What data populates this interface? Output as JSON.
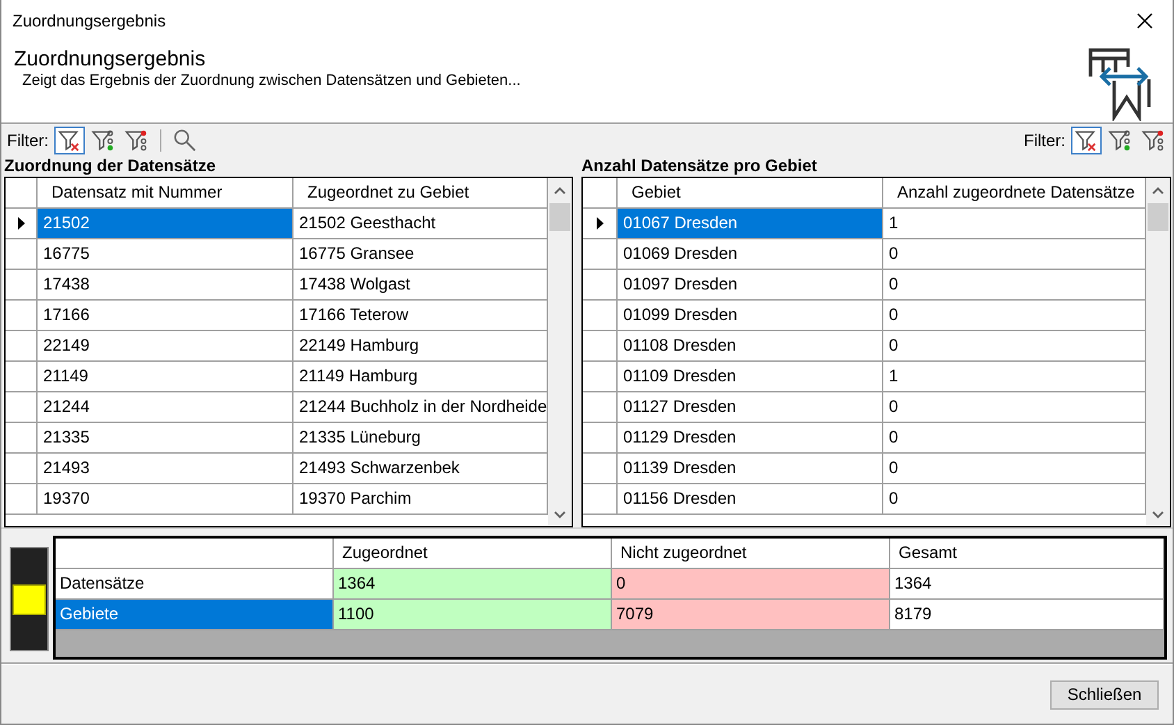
{
  "window": {
    "title": "Zuordnungsergebnis"
  },
  "header": {
    "title": "Zuordnungsergebnis",
    "subtitle": "Zeigt das Ergebnis der Zuordnung zwischen Datensätzen und Gebieten..."
  },
  "filters": [
    {
      "label": "Filter:",
      "buttons": [
        {
          "kind": "clear",
          "selected": true
        },
        {
          "kind": "assigned",
          "selected": false
        },
        {
          "kind": "unassigned",
          "selected": false
        },
        {
          "kind": "search",
          "selected": false
        }
      ]
    },
    {
      "label": "Filter:",
      "buttons": [
        {
          "kind": "clear",
          "selected": true
        },
        {
          "kind": "assigned",
          "selected": false
        },
        {
          "kind": "unassigned",
          "selected": false
        }
      ]
    }
  ],
  "grids": [
    {
      "title": "Zuordnung der Datensätze",
      "columns": [
        "Datensatz mit Nummer",
        "Zugeordnet zu Gebiet"
      ],
      "rows": [
        {
          "cells": [
            "21502",
            "21502 Geesthacht"
          ],
          "selected": true
        },
        {
          "cells": [
            "16775",
            "16775 Gransee"
          ],
          "selected": false
        },
        {
          "cells": [
            "17438",
            "17438 Wolgast"
          ],
          "selected": false
        },
        {
          "cells": [
            "17166",
            "17166 Teterow"
          ],
          "selected": false
        },
        {
          "cells": [
            "22149",
            "22149 Hamburg"
          ],
          "selected": false
        },
        {
          "cells": [
            "21149",
            "21149 Hamburg"
          ],
          "selected": false
        },
        {
          "cells": [
            "21244",
            "21244 Buchholz in der Nordheide"
          ],
          "selected": false
        },
        {
          "cells": [
            "21335",
            "21335 Lüneburg"
          ],
          "selected": false
        },
        {
          "cells": [
            "21493",
            "21493 Schwarzenbek"
          ],
          "selected": false
        },
        {
          "cells": [
            "19370",
            "19370 Parchim"
          ],
          "selected": false
        }
      ]
    },
    {
      "title": "Anzahl Datensätze pro Gebiet",
      "columns": [
        "Gebiet",
        "Anzahl zugeordnete Datensätze"
      ],
      "rows": [
        {
          "cells": [
            "01067 Dresden",
            "1"
          ],
          "selected": true
        },
        {
          "cells": [
            "01069 Dresden",
            "0"
          ],
          "selected": false
        },
        {
          "cells": [
            "01097 Dresden",
            "0"
          ],
          "selected": false
        },
        {
          "cells": [
            "01099 Dresden",
            "0"
          ],
          "selected": false
        },
        {
          "cells": [
            "01108 Dresden",
            "0"
          ],
          "selected": false
        },
        {
          "cells": [
            "01109 Dresden",
            "1"
          ],
          "selected": false
        },
        {
          "cells": [
            "01127 Dresden",
            "0"
          ],
          "selected": false
        },
        {
          "cells": [
            "01129 Dresden",
            "0"
          ],
          "selected": false
        },
        {
          "cells": [
            "01139 Dresden",
            "0"
          ],
          "selected": false
        },
        {
          "cells": [
            "01156 Dresden",
            "0"
          ],
          "selected": false
        }
      ]
    }
  ],
  "summary": {
    "columns": [
      {
        "label": "Zugeordnet",
        "color": "#c0ffc0"
      },
      {
        "label": "Nicht zugeordnet",
        "color": "#ffc0c0"
      },
      {
        "label": "Gesamt",
        "color": "#ffffff"
      }
    ],
    "rows": [
      {
        "label": "Datensätze",
        "values": [
          "1364",
          "0",
          "1364"
        ],
        "selected": false
      },
      {
        "label": "Gebiete",
        "values": [
          "1100",
          "7079",
          "8179"
        ],
        "selected": true
      }
    ]
  },
  "footer": {
    "close_button": "Schließen"
  }
}
